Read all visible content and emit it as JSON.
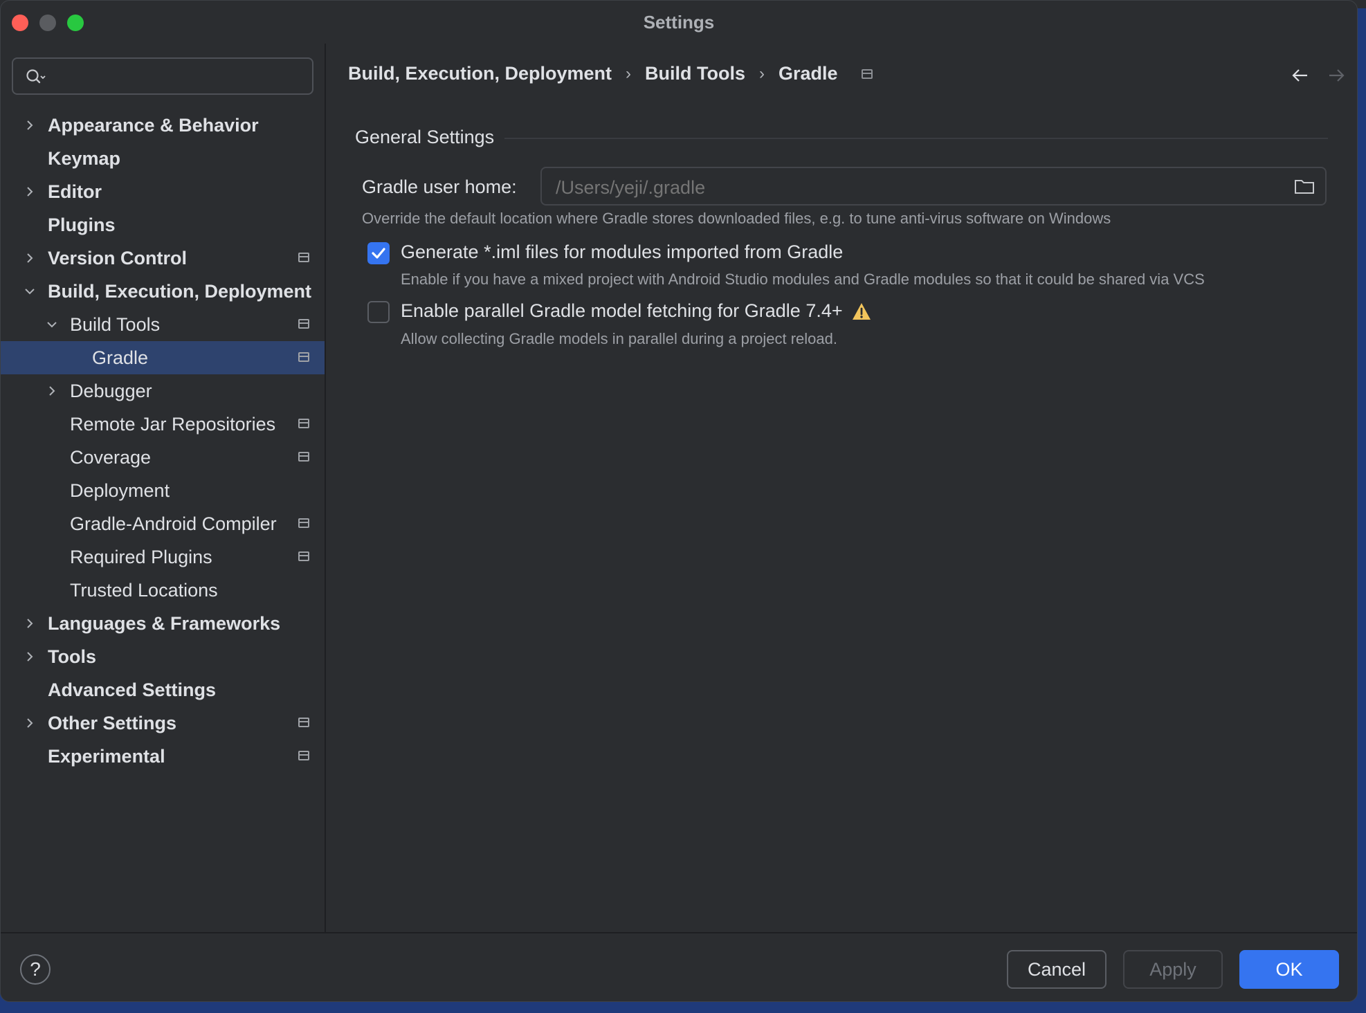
{
  "window": {
    "title": "Settings"
  },
  "search": {
    "value": "",
    "placeholder": ""
  },
  "tree": [
    {
      "label": "Appearance & Behavior",
      "bold": true,
      "indent": 0,
      "chevron": "right",
      "project": false,
      "selected": false
    },
    {
      "label": "Keymap",
      "bold": true,
      "indent": 0,
      "chevron": "none",
      "project": false,
      "selected": false
    },
    {
      "label": "Editor",
      "bold": true,
      "indent": 0,
      "chevron": "right",
      "project": false,
      "selected": false
    },
    {
      "label": "Plugins",
      "bold": true,
      "indent": 0,
      "chevron": "none",
      "project": false,
      "selected": false
    },
    {
      "label": "Version Control",
      "bold": true,
      "indent": 0,
      "chevron": "right",
      "project": true,
      "selected": false
    },
    {
      "label": "Build, Execution, Deployment",
      "bold": true,
      "indent": 0,
      "chevron": "down",
      "project": false,
      "selected": false
    },
    {
      "label": "Build Tools",
      "bold": false,
      "indent": 1,
      "chevron": "down",
      "project": true,
      "selected": false
    },
    {
      "label": "Gradle",
      "bold": false,
      "indent": 2,
      "chevron": "none",
      "project": true,
      "selected": true
    },
    {
      "label": "Debugger",
      "bold": false,
      "indent": 1,
      "chevron": "right",
      "project": false,
      "selected": false
    },
    {
      "label": "Remote Jar Repositories",
      "bold": false,
      "indent": 1,
      "chevron": "none",
      "project": true,
      "selected": false
    },
    {
      "label": "Coverage",
      "bold": false,
      "indent": 1,
      "chevron": "none",
      "project": true,
      "selected": false
    },
    {
      "label": "Deployment",
      "bold": false,
      "indent": 1,
      "chevron": "none",
      "project": false,
      "selected": false
    },
    {
      "label": "Gradle-Android Compiler",
      "bold": false,
      "indent": 1,
      "chevron": "none",
      "project": true,
      "selected": false
    },
    {
      "label": "Required Plugins",
      "bold": false,
      "indent": 1,
      "chevron": "none",
      "project": true,
      "selected": false
    },
    {
      "label": "Trusted Locations",
      "bold": false,
      "indent": 1,
      "chevron": "none",
      "project": false,
      "selected": false
    },
    {
      "label": "Languages & Frameworks",
      "bold": true,
      "indent": 0,
      "chevron": "right",
      "project": false,
      "selected": false
    },
    {
      "label": "Tools",
      "bold": true,
      "indent": 0,
      "chevron": "right",
      "project": false,
      "selected": false
    },
    {
      "label": "Advanced Settings",
      "bold": true,
      "indent": 0,
      "chevron": "none",
      "project": false,
      "selected": false
    },
    {
      "label": "Other Settings",
      "bold": true,
      "indent": 0,
      "chevron": "right",
      "project": true,
      "selected": false
    },
    {
      "label": "Experimental",
      "bold": true,
      "indent": 0,
      "chevron": "none",
      "project": true,
      "selected": false
    }
  ],
  "breadcrumb": {
    "items": [
      "Build, Execution, Deployment",
      "Build Tools",
      "Gradle"
    ],
    "separator": "›"
  },
  "general": {
    "section_title": "General Settings",
    "gradle_home_label": "Gradle user home:",
    "gradle_home_placeholder": "/Users/yeji/.gradle",
    "gradle_home_hint": "Override the default location where Gradle stores downloaded files, e.g. to tune anti-virus software on Windows",
    "iml_label": "Generate *.iml files for modules imported from Gradle",
    "iml_checked": true,
    "iml_hint": "Enable if you have a mixed project with Android Studio modules and Gradle modules so that it could be shared via VCS",
    "parallel_label": "Enable parallel Gradle model fetching for Gradle 7.4+",
    "parallel_checked": false,
    "parallel_hint": "Allow collecting Gradle models in parallel during a project reload."
  },
  "footer": {
    "help": "?",
    "cancel": "Cancel",
    "apply": "Apply",
    "ok": "OK"
  },
  "icons": {
    "search": "search-icon",
    "folder": "folder-icon",
    "warning": "warning-icon",
    "back": "arrow-left-icon",
    "forward": "arrow-right-icon",
    "project": "project-level-icon"
  },
  "colors": {
    "accent": "#3574f0",
    "selection": "#2e436e",
    "warning": "#f2c55c"
  }
}
